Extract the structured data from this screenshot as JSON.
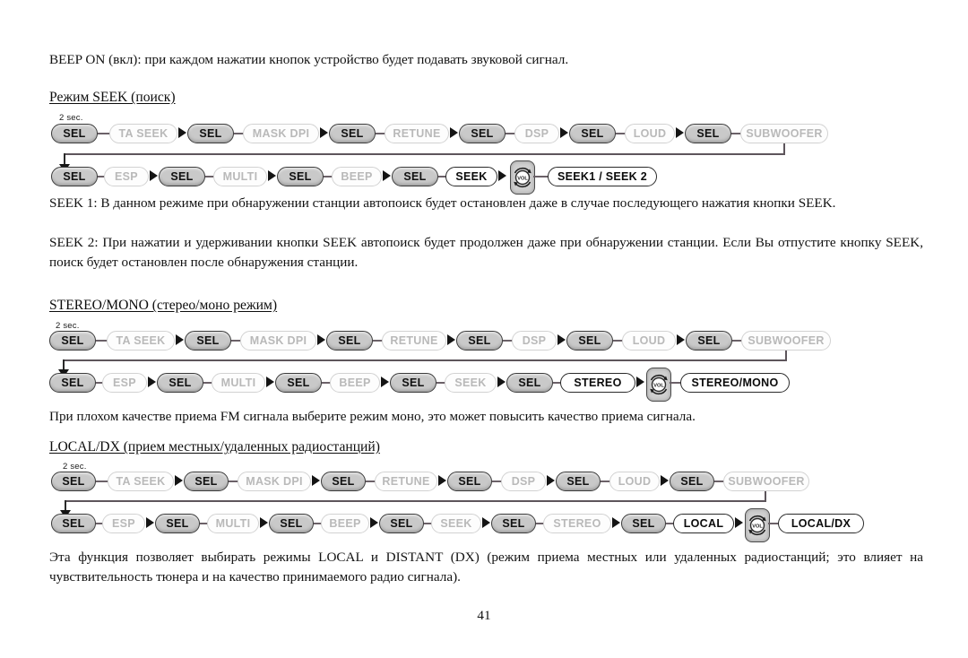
{
  "page": {
    "number": "41",
    "intro_paragraph": "BEEP ON (вкл): при каждом нажатии кнопок устройство будет подавать звуковой сигнал."
  },
  "sections": [
    {
      "heading": "Режим SEEK (поиск)",
      "diagram": {
        "hold_label": "2 sec.",
        "row1": [
          "SEL",
          "TA SEEK",
          "SEL",
          "MASK DPI",
          "SEL",
          "RETUNE",
          "SEL",
          "DSP",
          "SEL",
          "LOUD",
          "SEL",
          "SUBWOOFER"
        ],
        "row2": [
          "SEL",
          "ESP",
          "SEL",
          "MULTI",
          "SEL",
          "BEEP",
          "SEL",
          "SEEK"
        ],
        "knob_label": "VOL",
        "result": "SEEK1 / SEEK 2"
      },
      "paragraphs": [
        "SEEK 1: В данном режиме при обнаружении станции автопоиск будет остановлен даже в случае последующего нажатия кнопки SEEK.",
        "SEEK 2: При нажатии и удерживании кнопки SEEK автопоиск будет продолжен даже при обнаружении станции. Если Вы отпустите кнопку SEEK, поиск будет остановлен после обнаружения станции."
      ]
    },
    {
      "heading": "STEREO/MONO (стерео/моно режим)",
      "diagram": {
        "hold_label": "2 sec.",
        "row1": [
          "SEL",
          "TA SEEK",
          "SEL",
          "MASK DPI",
          "SEL",
          "RETUNE",
          "SEL",
          "DSP",
          "SEL",
          "LOUD",
          "SEL",
          "SUBWOOFER"
        ],
        "row2": [
          "SEL",
          "ESP",
          "SEL",
          "MULTI",
          "SEL",
          "BEEP",
          "SEL",
          "SEEK",
          "SEL",
          "STEREO"
        ],
        "knob_label": "VOL",
        "result": "STEREO/MONO"
      },
      "paragraphs": [
        "При плохом качестве приема FM сигнала выберите режим моно, это может повысить качество приема сигнала."
      ]
    },
    {
      "heading": "LOCAL/DX (прием местных/удаленных радиостанций)",
      "diagram": {
        "hold_label": "2 sec.",
        "row1": [
          "SEL",
          "TA SEEK",
          "SEL",
          "MASK DPI",
          "SEL",
          "RETUNE",
          "SEL",
          "DSP",
          "SEL",
          "LOUD",
          "SEL",
          "SUBWOOFER"
        ],
        "row2": [
          "SEL",
          "ESP",
          "SEL",
          "MULTI",
          "SEL",
          "BEEP",
          "SEL",
          "SEEK",
          "SEL",
          "STEREO",
          "SEL",
          "LOCAL"
        ],
        "knob_label": "VOL",
        "result": "LOCAL/DX"
      },
      "paragraphs": [
        "Эта функция позволяет выбирать режимы LOCAL и DISTANT (DX) (режим приема местных или удаленных радиостанций; это влияет на чувствительность тюнера и на качество принимаемого радио сигнала)."
      ]
    }
  ],
  "colors": {
    "pill_sel_fill": "#c9c9c9",
    "pill_ghost_text": "#b9b9b9",
    "connector": "#6b6168",
    "text": "#121212"
  }
}
